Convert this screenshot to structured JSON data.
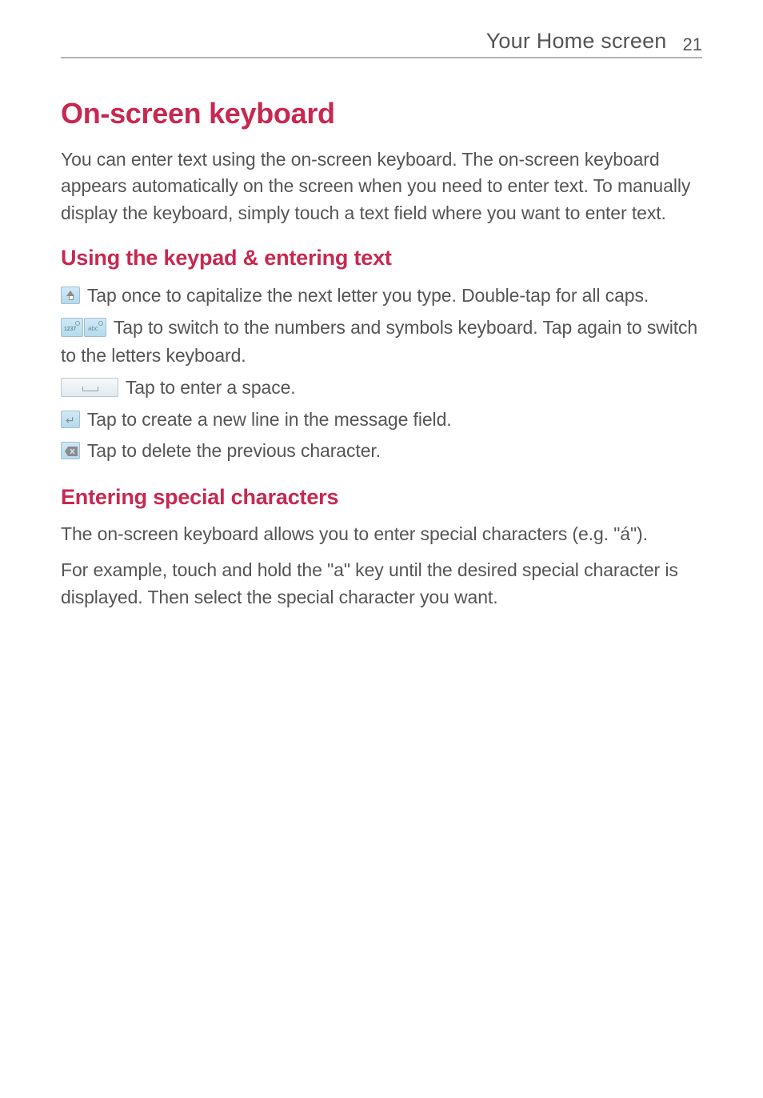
{
  "header": {
    "title": "Your Home screen",
    "page_number": "21"
  },
  "main": {
    "heading": "On-screen keyboard",
    "intro": "You can enter text using the on-screen keyboard. The on-screen keyboard appears automatically on the screen when you need to enter text. To manually display the keyboard, simply touch a text field where you want to enter text.",
    "subheading1": "Using the keypad & entering text",
    "keys": {
      "shift": " Tap once to capitalize the next letter you type. Double-tap for all caps.",
      "numsym": " Tap to switch to the numbers and symbols keyboard. Tap again to switch to the letters keyboard.",
      "space": " Tap to enter a space.",
      "enter": " Tap to create a new line in the message field.",
      "delete": " Tap to delete the previous character."
    },
    "subheading2": "Entering special characters",
    "special_p1": "The on-screen keyboard allows you to enter special characters (e.g. \"á\").",
    "special_p2": "For example, touch and hold the \"a\" key until the desired special character is displayed. Then select the special character you want."
  }
}
